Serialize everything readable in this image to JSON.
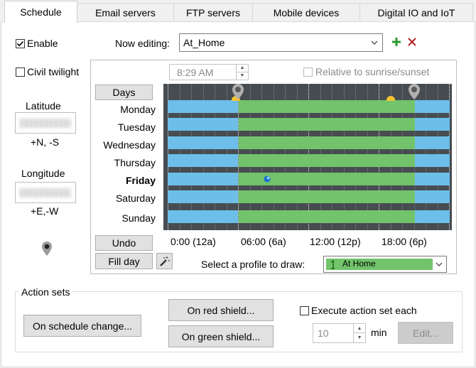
{
  "tabs": [
    {
      "label": "Schedule",
      "active": true
    },
    {
      "label": "Email servers",
      "active": false
    },
    {
      "label": "FTP servers",
      "active": false
    },
    {
      "label": "Mobile devices",
      "active": false
    },
    {
      "label": "Digital IO and IoT",
      "active": false
    }
  ],
  "left": {
    "enable_label": "Enable",
    "enable_checked": true,
    "civil_twilight_label": "Civil twilight",
    "civil_twilight_checked": false,
    "latitude_label": "Latitude",
    "latitude_hint": "+N, -S",
    "longitude_label": "Longitude",
    "longitude_hint": "+E,-W"
  },
  "editing": {
    "label": "Now editing:",
    "value": "At_Home"
  },
  "schedule": {
    "time_value": "8:29 AM",
    "relative_label": "Relative to sunrise/sunset",
    "relative_checked": false,
    "days_button": "Days",
    "days": [
      "Monday",
      "Tuesday",
      "Wednesday",
      "Thursday",
      "Friday",
      "Saturday",
      "Sunday"
    ],
    "today": "Friday",
    "time_labels": [
      "0:00 (12a)",
      "06:00 (6a)",
      "12:00 (12p)",
      "18:00 (6p)"
    ],
    "undo_button": "Undo",
    "fill_day_button": "Fill day",
    "profile_label": "Select a profile to draw:",
    "profile_value": "At Home",
    "profile_color": "#72c36b",
    "away_color": "#6dbfe9",
    "grid_color": "#474c51",
    "home_from_hour": 6.0,
    "home_to_hour": 21.0,
    "marker_day": "Friday",
    "marker_hour": 8.48
  },
  "actions": {
    "group_label": "Action sets",
    "schedule_change_button": "On schedule change...",
    "red_shield_button": "On red shield...",
    "green_shield_button": "On green shield...",
    "execute_label": "Execute action set each",
    "execute_checked": false,
    "interval_value": "10",
    "interval_unit": "min",
    "edit_button": "Edit..."
  },
  "icons": {
    "add": "plus-icon",
    "delete": "x-icon",
    "location": "map-pin-icon",
    "wand": "magic-wand-icon",
    "sun": "sun-icon",
    "moon": "moon-icon",
    "checkmark": "checkmark-icon"
  }
}
